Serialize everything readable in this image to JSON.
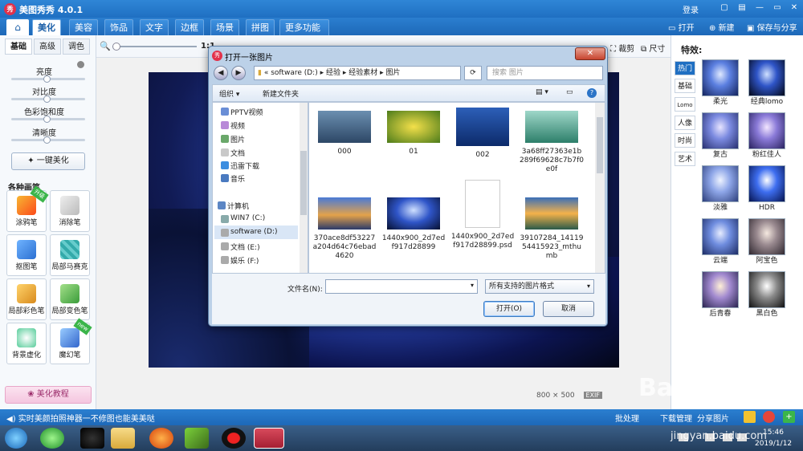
{
  "app": {
    "title": "美图秀秀 4.0.1",
    "logo": "秀",
    "login": "登录"
  },
  "menu": {
    "tabs": [
      "美化",
      "美容",
      "饰品",
      "文字",
      "边框",
      "场景",
      "拼图",
      "更多功能"
    ],
    "open_label": "打开",
    "new_label": "新建",
    "save_label": "保存与分享"
  },
  "left": {
    "subtabs": [
      "基础",
      "高级",
      "调色"
    ],
    "sliders": [
      "亮度",
      "对比度",
      "色彩饱和度",
      "清晰度"
    ],
    "auto_button": "一键美化",
    "brush_title": "各种画笔",
    "tools": [
      "涂鸦笔",
      "消除笔",
      "抠图笔",
      "局部马赛克",
      "局部彩色笔",
      "局部变色笔",
      "背景虚化",
      "魔幻笔"
    ],
    "tool_badges": {
      "tool0": "升级",
      "tool7": "new"
    },
    "tutorial": "美化教程"
  },
  "toolbar": {
    "zoom_prefix": "1:1",
    "actions": [
      "裁剪",
      "尺寸"
    ]
  },
  "image": {
    "size": "800 × 500",
    "exif": "EXIF"
  },
  "right": {
    "title": "特效:",
    "tabs": [
      "热门",
      "基础",
      "Lomo",
      "人像",
      "时尚",
      "艺术"
    ],
    "effects": [
      "柔光",
      "经典lomo",
      "复古",
      "粉红佳人",
      "淡雅",
      "HDR",
      "云端",
      "阿宝色",
      "后青春",
      "黑白色"
    ]
  },
  "status": {
    "tip": "实时美颜拍照神器一不修图也能美美哒",
    "batch": "批处理",
    "download": "下载管理",
    "share": "分享图片"
  },
  "dialog": {
    "title": "打开一张图片",
    "close": "✕",
    "path": [
      "«",
      "software (D:)",
      "经验",
      "经验素材",
      "图片"
    ],
    "search_placeholder": "搜索 图片",
    "organize": "组织 ▾",
    "new_folder": "新建文件夹",
    "nav_items": [
      "PPTV视频",
      "视频",
      "图片",
      "文档",
      "迅雷下载",
      "音乐"
    ],
    "computer": "计算机",
    "drives": [
      "WIN7 (C:)",
      "software (D:)",
      "文档 (E:)",
      "娱乐 (F:)"
    ],
    "files": [
      "000",
      "01",
      "002",
      "3a68ff27363e1b289f69628c7b7f0e0f",
      "370ace8df53227a204d64c76ebad4620",
      "1440x900_2d7edf917d28899",
      "1440x900_2d7edf917d28899.psd",
      "39107284_1411954415923_mthumb"
    ],
    "filename_label": "文件名(N):",
    "filetype": "所有支持的图片格式",
    "open_btn": "打开(O)",
    "cancel_btn": "取消"
  },
  "taskbar": {
    "time": "15:46",
    "date": "2019/1/12"
  },
  "watermark": {
    "main": "Baidu 经验",
    "sub": "jingyan.baidu.com"
  }
}
